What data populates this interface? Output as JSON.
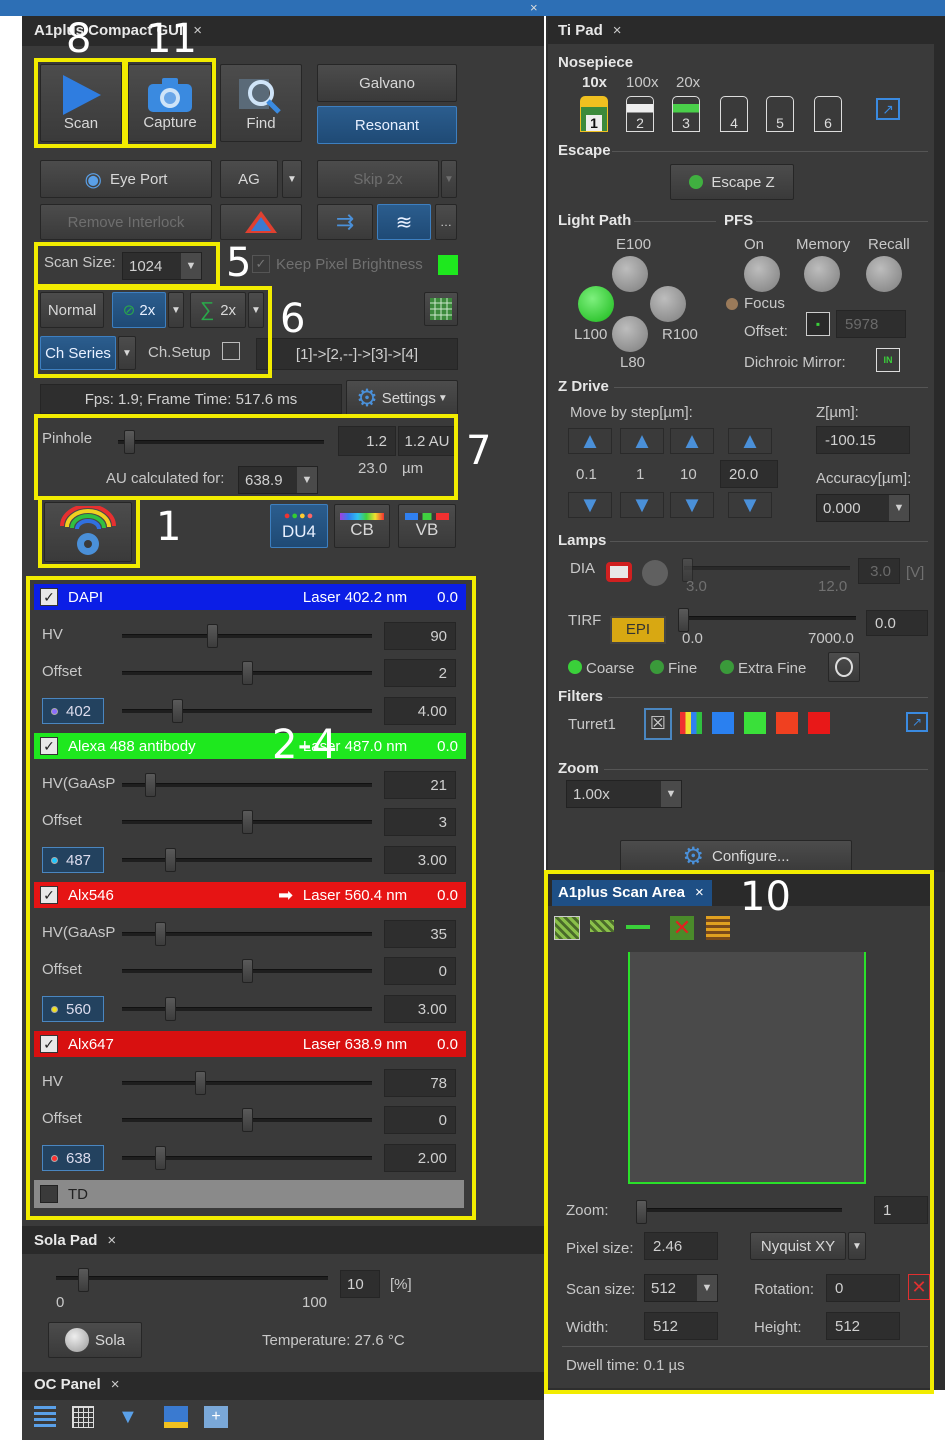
{
  "window": {
    "title_close": "×"
  },
  "compact": {
    "tab_title": "A1plus Compact GUI",
    "scan": "Scan",
    "capture": "Capture",
    "find": "Find",
    "galvano": "Galvano",
    "resonant": "Resonant",
    "eye_port": "Eye Port",
    "ag": "AG",
    "skip": "Skip 2x",
    "remove_interlock": "Remove Interlock",
    "scan_size_label": "Scan Size:",
    "scan_size_value": "1024",
    "keep_pixel": "Keep Pixel Brightness",
    "normal": "Normal",
    "avg": "2x",
    "sum": "2x",
    "ch_series": "Ch Series",
    "ch_setup": "Ch.Setup",
    "sequence": "[1]->[2,--]->[3]->[4]",
    "fps": "Fps: 1.9; Frame Time: 517.6 ms",
    "settings": "Settings",
    "pinhole": "Pinhole",
    "pinhole_value": "1.2",
    "pinhole_au": "1.2 AU",
    "pinhole_um": "23.0",
    "um_unit": "µm",
    "au_for": "AU calculated for:",
    "au_for_value": "638.9",
    "du4": "DU4",
    "cb": "CB",
    "vb": "VB"
  },
  "channels": [
    {
      "name": "DAPI",
      "laser": "Laser 402.2 nm",
      "power": "0.0",
      "color": "#0b1ee6",
      "hv_label": "HV",
      "hv": "90",
      "hv_pos": 0.36,
      "offset": "2",
      "offset_pos": 0.5,
      "wl": "402",
      "laser_val": "4.00",
      "laser_pos": 0.22,
      "dotcolor": "#8a6cff"
    },
    {
      "name": "Alexa 488 antibody",
      "laser": "Laser 487.0 nm",
      "power": "0.0",
      "color": "#1ee81e",
      "hv_label": "HV(GaAsP",
      "hv": "21",
      "hv_pos": 0.11,
      "offset": "3",
      "offset_pos": 0.5,
      "wl": "487",
      "laser_val": "3.00",
      "laser_pos": 0.19,
      "dotcolor": "#20c8ff"
    },
    {
      "name": "Alx546",
      "laser": "Laser 560.4 nm",
      "power": "0.0",
      "color": "#e61414",
      "hv_label": "HV(GaAsP",
      "hv": "35",
      "hv_pos": 0.15,
      "offset": "0",
      "offset_pos": 0.5,
      "wl": "560",
      "laser_val": "3.00",
      "laser_pos": 0.19,
      "dotcolor": "#f0e020"
    },
    {
      "name": "Alx647",
      "laser": "Laser 638.9 nm",
      "power": "0.0",
      "color": "#d81010",
      "hv_label": "HV",
      "hv": "78",
      "hv_pos": 0.31,
      "offset": "0",
      "offset_pos": 0.5,
      "wl": "638",
      "laser_val": "2.00",
      "laser_pos": 0.15,
      "dotcolor": "#ff3030"
    }
  ],
  "td": "TD",
  "offset_label": "Offset",
  "sola": {
    "tab": "Sola Pad",
    "value": "10",
    "unit": "[%]",
    "min": "0",
    "max": "100",
    "button": "Sola",
    "temperature": "Temperature: 27.6 °C"
  },
  "oc": {
    "tab": "OC Panel"
  },
  "tipad": {
    "tab": "Ti Pad",
    "nosepiece": "Nosepiece",
    "obj": [
      "10x",
      "100x",
      "20x"
    ],
    "slots": [
      "1",
      "2",
      "3",
      "4",
      "5",
      "6"
    ],
    "escape": "Escape",
    "escape_z": "Escape Z",
    "light_path": "Light Path",
    "e100": "E100",
    "l100": "L100",
    "r100": "R100",
    "l80": "L80",
    "pfs": "PFS",
    "on": "On",
    "memory": "Memory",
    "recall": "Recall",
    "focus": "Focus",
    "offset_label": "Offset:",
    "offset_value": "5978",
    "dichroic": "Dichroic Mirror:",
    "in": "IN",
    "zdrive": "Z Drive",
    "move_by": "Move by step[µm]:",
    "zum": "Z[µm]:",
    "z_value": "-100.15",
    "steps": [
      "0.1",
      "1",
      "10"
    ],
    "custom_step": "20.0",
    "accuracy": "Accuracy[µm]:",
    "accuracy_value": "0.000",
    "lamps": "Lamps",
    "dia": "DIA",
    "dia_min": "3.0",
    "dia_max": "12.0",
    "dia_value": "3.0",
    "dia_unit": "[V]",
    "tirf": "TIRF",
    "epi": "EPI",
    "tirf_min": "0.0",
    "tirf_max": "7000.0",
    "tirf_value": "0.0",
    "coarse": "Coarse",
    "fine": "Fine",
    "extra_fine": "Extra Fine",
    "filters": "Filters",
    "turret": "Turret1",
    "zoom": "Zoom",
    "zoom_value": "1.00x",
    "configure": "Configure..."
  },
  "scanarea": {
    "tab": "A1plus Scan Area",
    "zoom_label": "Zoom:",
    "zoom_value": "1",
    "pixel_size_label": "Pixel size:",
    "pixel_size": "2.46",
    "nyquist": "Nyquist XY",
    "scan_size_label": "Scan size:",
    "scan_size": "512",
    "rotation_label": "Rotation:",
    "rotation": "0",
    "width_label": "Width:",
    "width": "512",
    "height_label": "Height:",
    "height": "512",
    "dwell": "Dwell time: 0.1 µs"
  },
  "annotations": {
    "n8": "8",
    "n11": "11",
    "n5": "5",
    "n6": "6",
    "n7": "7",
    "n1": "1",
    "n24": "2-4",
    "n10": "10"
  }
}
